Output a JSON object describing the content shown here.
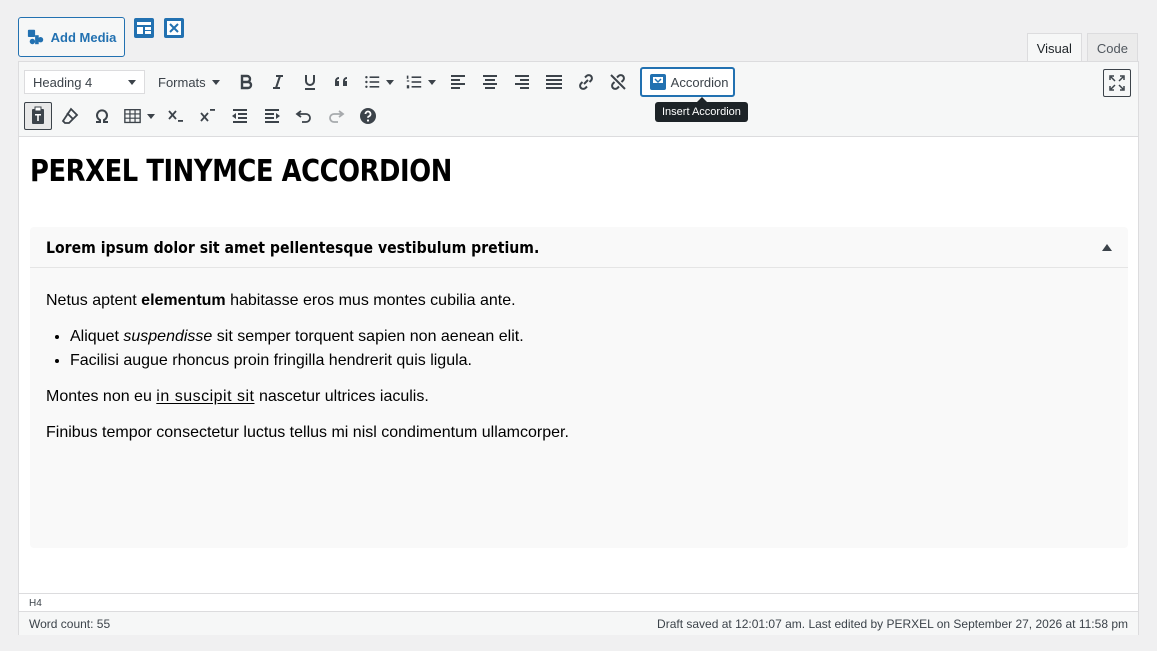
{
  "media": {
    "add_media_label": "Add Media"
  },
  "tabs": [
    {
      "label": "Visual"
    },
    {
      "label": "Code"
    }
  ],
  "toolbar": {
    "block_format": "Heading 4",
    "formats_label": "Formats",
    "accordion_label": "Accordion",
    "accordion_tooltip": "Insert Accordion"
  },
  "content": {
    "title": "PERXEL TINYMCE ACCORDION",
    "accordion": {
      "heading": "Lorem ipsum dolor sit amet pellentesque vestibulum pretium.",
      "p1_before": "Netus aptent ",
      "p1_bold": "elementum",
      "p1_after": " habitasse eros mus montes cubilia ante.",
      "li1_before": "Aliquet ",
      "li1_italic": "suspendisse",
      "li1_after": " sit semper torquent sapien non aenean elit.",
      "li2": "Facilisi augue rhoncus proin fringilla hendrerit quis ligula.",
      "p2_before": "Montes non eu ",
      "p2_underline": "in suscipit sit",
      "p2_after": " nascetur ultrices iaculis.",
      "p3": "Finibus tempor consectetur luctus tellus mi nisl condimentum ullamcorper."
    }
  },
  "path": "H4",
  "status": {
    "word_count": "Word count: 55",
    "draft": "Draft saved at 12:01:07 am. Last edited by PERXEL on September 27, 2026 at 11:58 pm"
  },
  "colors": {
    "accent": "#2271b1",
    "toolbar_bg": "#f6f7f7",
    "accordion_bg": "#f9f9f9"
  }
}
